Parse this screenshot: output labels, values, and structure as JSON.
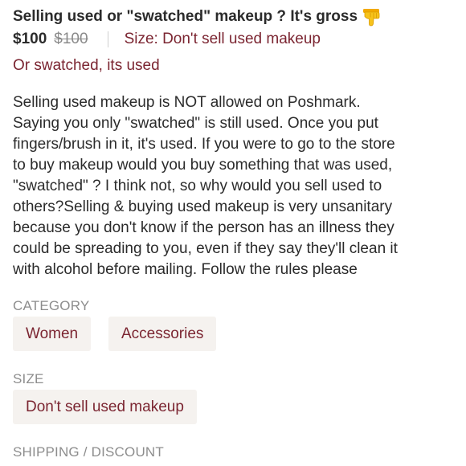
{
  "listing": {
    "title": "Selling used or \"swatched\" makeup ? It's gross",
    "title_icon": "thumbs-down-icon",
    "price": "$100",
    "original_price": "$100",
    "size_inline": "Size: Don't sell used makeup",
    "subtitle": "Or swatched, its used",
    "description_lines": [
      "Selling used makeup is NOT allowed on Poshmark.",
      "Saying you only \"swatched\" is still used. Once you put",
      "fingers/brush in it, it's used. If you were to go to the store",
      "to buy makeup would you buy something that was used,",
      "\"swatched\" ? I think not, so why would you sell used to",
      "others?Selling & buying used makeup is very unsanitary",
      "because you don't know if the person has an illness they",
      "could be spreading to you, even if they say they'll clean it",
      "with alcohol before mailing. Follow the rules please"
    ]
  },
  "category": {
    "label": "CATEGORY",
    "chips": [
      "Women",
      "Accessories"
    ]
  },
  "size": {
    "label": "SIZE",
    "chips": [
      "Don't sell used makeup"
    ]
  },
  "shipping": {
    "label": "SHIPPING / DISCOUNT"
  },
  "colors": {
    "accent": "#7b2531",
    "text": "#2b2b2b",
    "muted": "#8d8d8d",
    "chip_bg": "#f5f2ef",
    "emoji": "#f7c31b"
  }
}
